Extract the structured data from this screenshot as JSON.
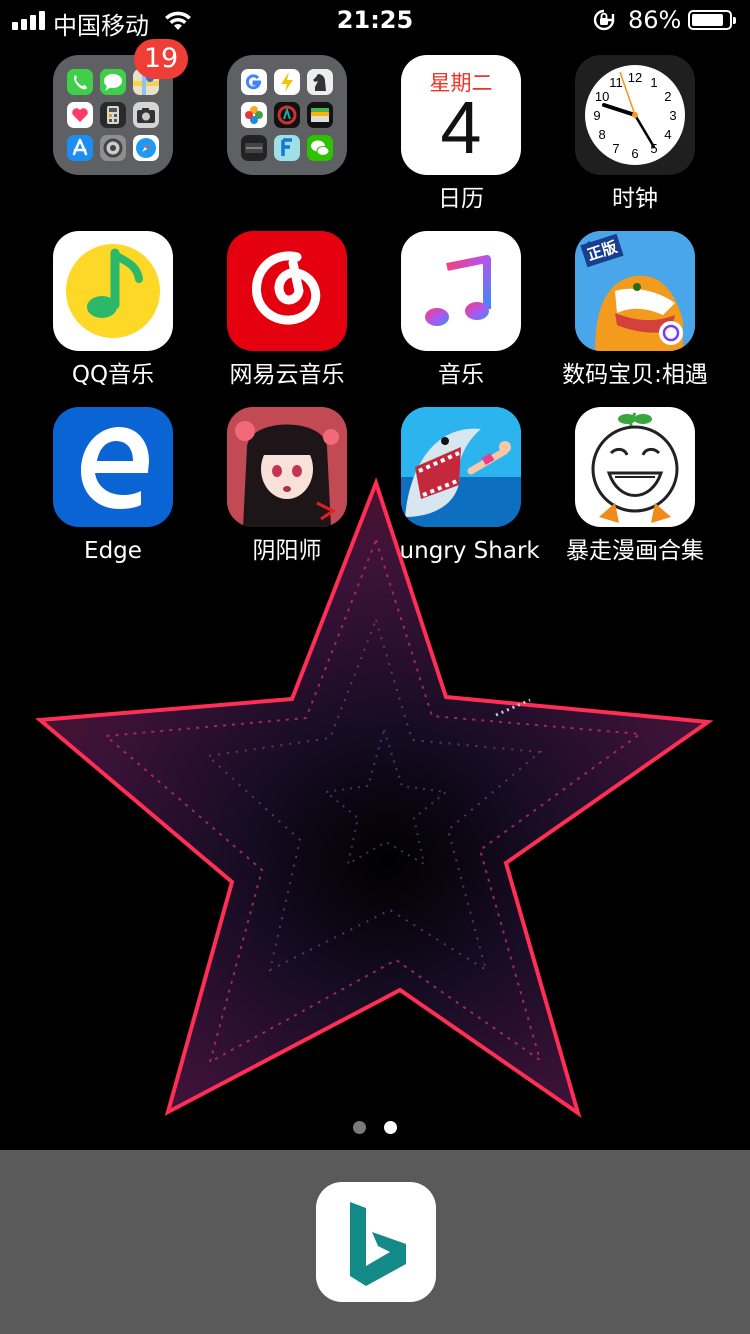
{
  "status_bar": {
    "carrier": "中国移动",
    "time": "21:25",
    "battery_percent": "86%",
    "battery_level": 0.86
  },
  "apps": {
    "folder1": {
      "badge": "19",
      "label": ""
    },
    "folder2": {
      "label": ""
    },
    "calendar": {
      "weekday": "星期二",
      "day": "4",
      "label": "日历"
    },
    "clock": {
      "label": "时钟",
      "numerals": [
        "12",
        "1",
        "2",
        "3",
        "4",
        "5",
        "6",
        "7",
        "8",
        "9",
        "10",
        "11"
      ]
    },
    "qq_music": {
      "label": "QQ音乐"
    },
    "netease": {
      "label": "网易云音乐"
    },
    "music": {
      "label": "音乐"
    },
    "digimon": {
      "label": "数码宝贝:相遇",
      "tag": "正版"
    },
    "edge": {
      "label": "Edge"
    },
    "onmyoji": {
      "label": "阴阳师"
    },
    "hungry_shark": {
      "label": "Hungry Shark"
    },
    "baozou": {
      "label": "暴走漫画合集"
    }
  },
  "page_indicator": {
    "pages": 2,
    "current": 2
  },
  "dock": {
    "apps": [
      {
        "name": "Bing"
      }
    ]
  },
  "icons": {
    "signal": "signal-bars-icon",
    "wifi": "wifi-icon",
    "rotation_lock": "rotation-lock-icon",
    "battery": "battery-icon"
  },
  "colors": {
    "badge": "#ef3e35",
    "calendar_weekday": "#ef3324",
    "netease_red": "#e4000f",
    "qq_yellow": "#fdd826",
    "qq_green": "#2bb868",
    "edge_blue": "#0a64d4",
    "bing_teal": "#138a87",
    "star_edge": "#ff2e55",
    "dock_bg": "#5a5a5a"
  }
}
